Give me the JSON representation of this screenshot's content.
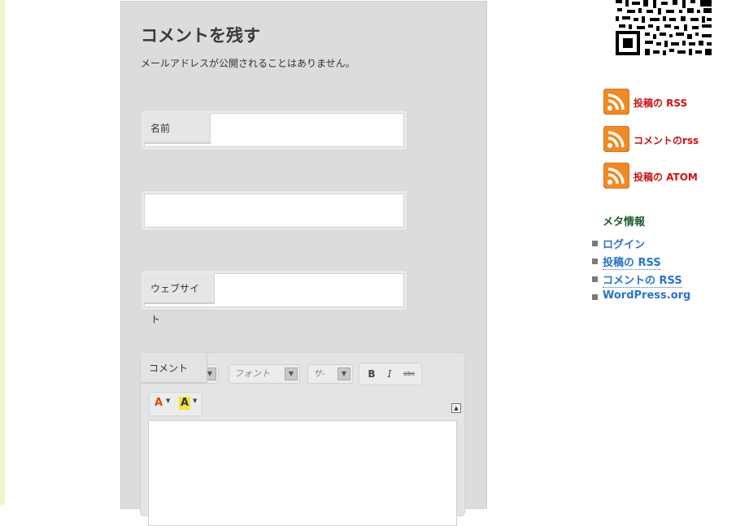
{
  "comment_form": {
    "title": "コメントを残す",
    "notice": "メールアドレスが公開されることはありません。",
    "fields": {
      "name_label": "名前",
      "email_label": "",
      "website_label": "ウェブサイト",
      "comment_label": "コメント"
    },
    "editor": {
      "font_select": "フォント",
      "size_select": "サ-",
      "bold": "B",
      "italic": "I",
      "strike": "abc",
      "text_color": "A",
      "highlight": "A",
      "collapse": "▲"
    }
  },
  "sidebar": {
    "feeds": [
      {
        "label": "投稿の RSS"
      },
      {
        "label": "コメントのrss"
      },
      {
        "label": "投稿の ATOM"
      }
    ],
    "meta": {
      "title": "メタ情報",
      "links": [
        "ログイン",
        "投稿の RSS",
        "コメントの RSS",
        "WordPress.org"
      ]
    }
  },
  "icons": [
    "qr-code-icon",
    "rss-icon",
    "bold-icon",
    "italic-icon",
    "strikethrough-icon",
    "text-color-icon",
    "highlight-icon",
    "collapse-icon"
  ],
  "colors": {
    "panel_bg": "#dcdcdc",
    "feed_label": "#cc1111",
    "meta_title": "#1e5b2f",
    "link": "#2a72c6",
    "rss_orange": "#f08a24"
  }
}
